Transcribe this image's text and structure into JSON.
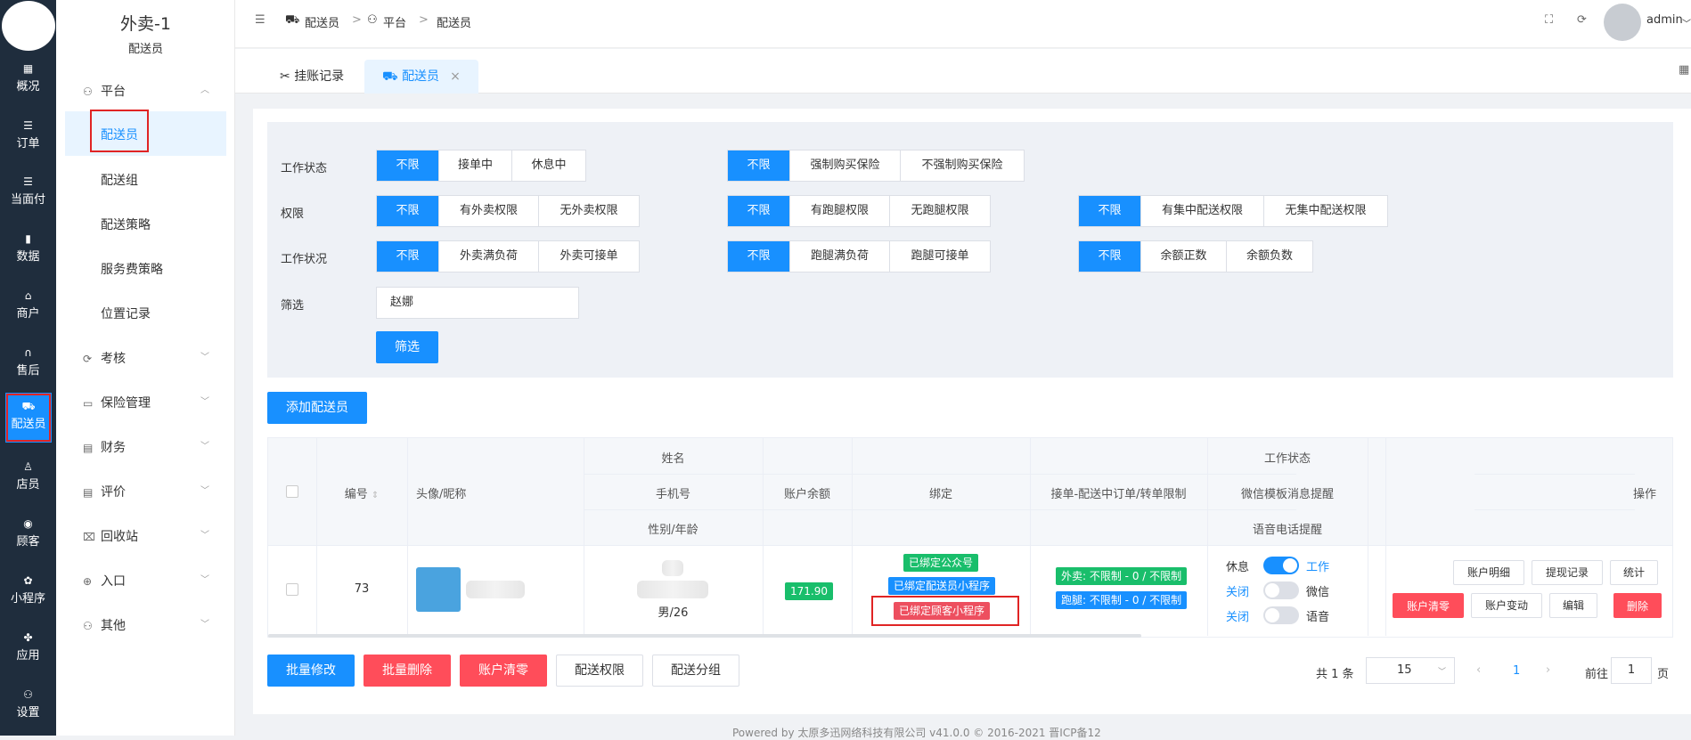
{
  "leftnav": {
    "items": [
      {
        "icon": "dashboard-icon",
        "glyph": "▦",
        "label": "概况"
      },
      {
        "icon": "orders-icon",
        "glyph": "☰",
        "label": "订单"
      },
      {
        "icon": "face-pay-icon",
        "glyph": "☰",
        "label": "当面付"
      },
      {
        "icon": "data-chart-icon",
        "glyph": "▮",
        "label": "数据"
      },
      {
        "icon": "merchant-icon",
        "glyph": "⌂",
        "label": "商户"
      },
      {
        "icon": "headset-icon",
        "glyph": "∩",
        "label": "售后"
      },
      {
        "icon": "rider-icon",
        "glyph": "⛟",
        "label": "配送员"
      },
      {
        "icon": "store-user-icon",
        "glyph": "♙",
        "label": "店员"
      },
      {
        "icon": "customer-icon",
        "glyph": "◉",
        "label": "顾客"
      },
      {
        "icon": "miniprogram-icon",
        "glyph": "✿",
        "label": "小程序"
      },
      {
        "icon": "apps-icon",
        "glyph": "✤",
        "label": "应用"
      },
      {
        "icon": "settings-icon",
        "glyph": "⚇",
        "label": "设置"
      }
    ]
  },
  "subnav": {
    "title": "外卖-1",
    "subtitle": "配送员",
    "platform_group": "平台",
    "links": [
      "配送员",
      "配送组",
      "配送策略",
      "服务费策略",
      "位置记录"
    ],
    "groups": [
      {
        "icon": "audit-icon",
        "glyph": "⟳",
        "label": "考核"
      },
      {
        "icon": "insurance-icon",
        "glyph": "▭",
        "label": "保险管理"
      },
      {
        "icon": "finance-icon",
        "glyph": "▤",
        "label": "财务"
      },
      {
        "icon": "review-icon",
        "glyph": "▤",
        "label": "评价"
      },
      {
        "icon": "recycle-icon",
        "glyph": "⌧",
        "label": "回收站"
      },
      {
        "icon": "entry-icon",
        "glyph": "⊕",
        "label": "入口"
      },
      {
        "icon": "other-icon",
        "glyph": "⚇",
        "label": "其他"
      }
    ]
  },
  "topbar": {
    "breadcrumb": [
      "配送员",
      "平台",
      "配送员"
    ],
    "separator": ">",
    "user": "admin"
  },
  "tabs": [
    {
      "label": "挂账记录",
      "icon": "tools-icon"
    },
    {
      "label": "配送员",
      "icon": "rider-icon",
      "close": "×"
    }
  ],
  "filters": {
    "work_status_label": "工作状态",
    "work_status": [
      "不限",
      "接单中",
      "休息中"
    ],
    "insurance": [
      "不限",
      "强制购买保险",
      "不强制购买保险"
    ],
    "permission_label": "权限",
    "takeout_perm": [
      "不限",
      "有外卖权限",
      "无外卖权限"
    ],
    "errand_perm": [
      "不限",
      "有跑腿权限",
      "无跑腿权限"
    ],
    "central_perm": [
      "不限",
      "有集中配送权限",
      "无集中配送权限"
    ],
    "work_condition_label": "工作状况",
    "takeout_load": [
      "不限",
      "外卖满负荷",
      "外卖可接单"
    ],
    "errand_load": [
      "不限",
      "跑腿满负荷",
      "跑腿可接单"
    ],
    "balance": [
      "不限",
      "余额正数",
      "余额负数"
    ],
    "search_label": "筛选",
    "search_value": "赵娜",
    "search_button": "筛选"
  },
  "add_button": "添加配送员",
  "table": {
    "headers": {
      "id": "编号",
      "avatar": "头像/昵称",
      "name": "姓名",
      "phone": "手机号",
      "gender_age": "性别/年龄",
      "balance": "账户余额",
      "binding": "绑定",
      "limit": "接单-配送中订单/转单限制",
      "work_status": "工作状态",
      "wechat_msg": "微信模板消息提醒",
      "voice": "语音电话提醒",
      "actions": "操作"
    },
    "row": {
      "id": "73",
      "gender_age": "男/26",
      "balance": "171.90",
      "bind_tags": [
        "已绑定公众号",
        "已绑定配送员小程序",
        "已绑定顾客小程序"
      ],
      "limit_tags": [
        "外卖: 不限制 - 0 / 不限制",
        "跑腿: 不限制 - 0 / 不限制"
      ],
      "switches": [
        {
          "left": "休息",
          "right": "工作",
          "on": true
        },
        {
          "left": "关闭",
          "right": "微信",
          "on": false
        },
        {
          "left": "关闭",
          "right": "语音",
          "on": false
        }
      ],
      "actions_row1": [
        "账户明细",
        "提现记录",
        "统计"
      ],
      "actions_row2": [
        "账户清零",
        "账户变动",
        "编辑",
        "删除"
      ]
    }
  },
  "bottom_buttons": [
    "批量修改",
    "批量删除",
    "账户清零",
    "配送权限",
    "配送分组"
  ],
  "pagination": {
    "total": "共 1 条",
    "page_size": "15",
    "current": "1",
    "goto_label": "前往",
    "goto_value": "1",
    "page_suffix": "页"
  },
  "footer": "Powered by 太原多迅网络科技有限公司 v41.0.0 © 2016-2021 晋ICP备12"
}
